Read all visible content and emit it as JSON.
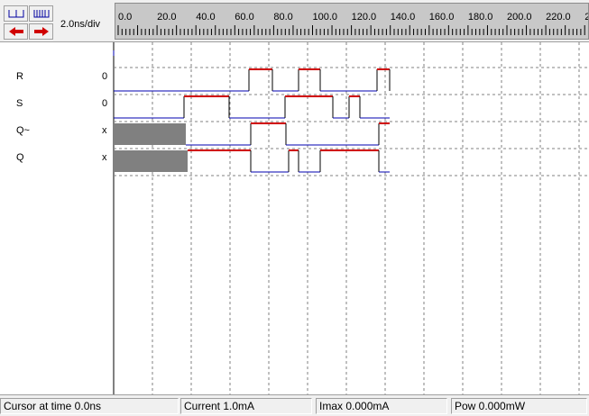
{
  "toolbar": {
    "zoom_in_icon": "zoom-in-icon",
    "zoom_out_icon": "zoom-out-icon",
    "scroll_left_icon": "scroll-left-icon",
    "scroll_right_icon": "scroll-right-icon",
    "time_scale": "2.0ns/div"
  },
  "ruler": {
    "tick_labels": [
      "0.0",
      "20.0",
      "40.0",
      "60.0",
      "80.0",
      "100.0",
      "120.0",
      "140.0",
      "160.0",
      "180.0",
      "200.0",
      "220.0",
      "24"
    ]
  },
  "signals": [
    {
      "name": "R",
      "value": "0"
    },
    {
      "name": "S",
      "value": "0"
    },
    {
      "name": "Q~",
      "value": "x"
    },
    {
      "name": "Q",
      "value": "x"
    }
  ],
  "status": {
    "cursor": "Cursor at time  0.0ns",
    "current": "Current  1.0mA",
    "imax": "Imax 0.000mA",
    "pow": "Pow 0.000mW"
  },
  "colors": {
    "high": "#d00000",
    "low": "#0000b0",
    "unknown": "#808080",
    "grid": "#808080"
  }
}
